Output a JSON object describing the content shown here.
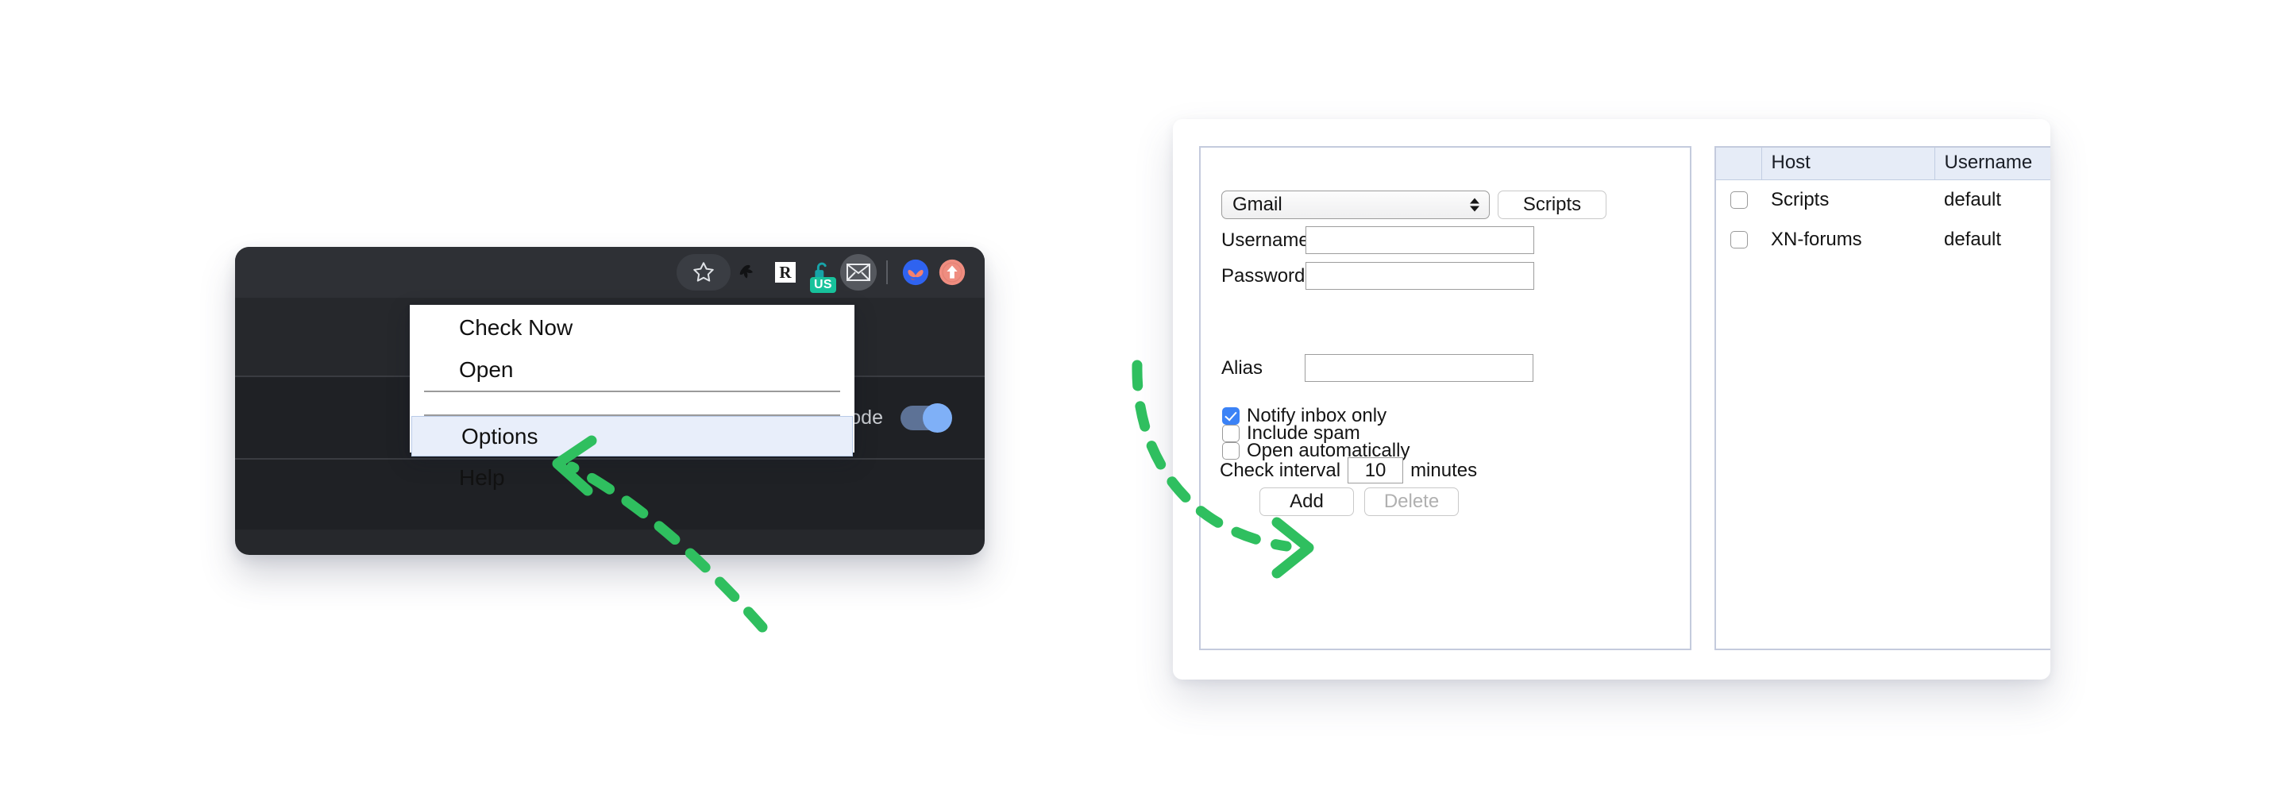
{
  "browser": {
    "toolbar_icons": [
      {
        "name": "bookmark-star-icon",
        "glyph": "☆"
      },
      {
        "name": "ghostery-icon",
        "glyph": "✦"
      },
      {
        "name": "reddit-enhancement-icon",
        "glyph": "R"
      },
      {
        "name": "lastpass-unlock-icon",
        "glyph": "🔓",
        "badge": "US"
      },
      {
        "name": "checker-plus-mail-icon",
        "glyph": "✉"
      },
      {
        "name": "bluesky-butterfly-icon",
        "glyph": "●"
      },
      {
        "name": "uploader-arrow-icon",
        "glyph": "⬆"
      }
    ],
    "rows": [
      {
        "label": "",
        "toggle": false
      },
      {
        "label": "mode",
        "toggle": true
      },
      {
        "label": "",
        "toggle": false
      }
    ]
  },
  "context_menu": {
    "items": [
      {
        "label": "Check Now",
        "highlighted": false
      },
      {
        "label": "Open",
        "highlighted": false
      },
      {
        "label": "Options",
        "highlighted": true
      },
      {
        "label": "Help",
        "highlighted": false
      }
    ]
  },
  "options": {
    "account_select": {
      "value": "Gmail",
      "options": [
        "Gmail"
      ]
    },
    "scripts_button": "Scripts",
    "username": {
      "label": "Username",
      "value": "",
      "placeholder": ""
    },
    "password": {
      "label": "Password",
      "value": "",
      "placeholder": ""
    },
    "alias": {
      "label": "Alias",
      "value": "",
      "placeholder": ""
    },
    "checkboxes": [
      {
        "label": "Notify inbox only",
        "checked": true
      },
      {
        "label": "Include spam",
        "checked": false
      },
      {
        "label": "Open automatically",
        "checked": false
      }
    ],
    "interval": {
      "label": "Check interval",
      "value": "10",
      "unit": "minutes"
    },
    "add_button": "Add",
    "delete_button": "Delete"
  },
  "accounts_table": {
    "columns": [
      "",
      "Host",
      "Username"
    ],
    "rows": [
      {
        "selected": false,
        "host": "Scripts",
        "username": "default"
      },
      {
        "selected": false,
        "host": "XN-forums",
        "username": "default"
      }
    ]
  },
  "annotations": {
    "arrow_color": "#2fbf5f",
    "arrow_1_target": "Options",
    "arrow_2_target": "Add"
  }
}
